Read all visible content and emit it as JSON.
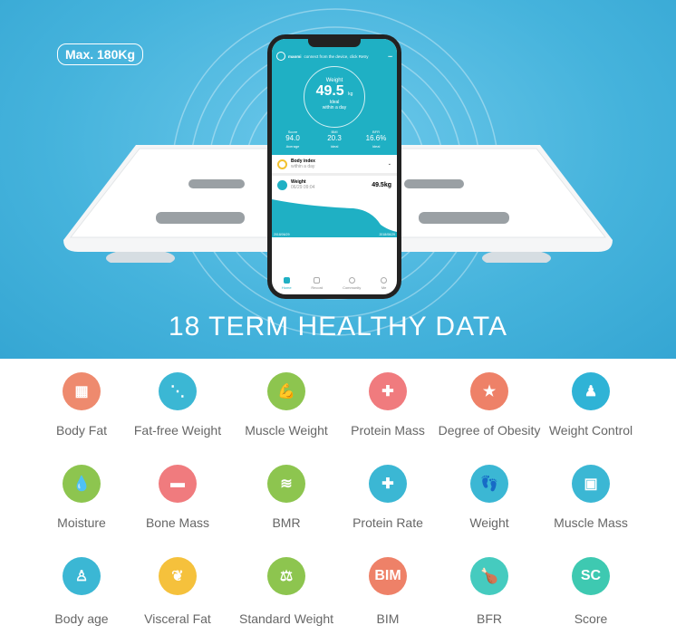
{
  "banner": {
    "badge": "Max. 180Kg",
    "title": "18 TERM HEALTHY DATA"
  },
  "app": {
    "brand": "maomi",
    "header_text": "connect from the device, click Retry",
    "menu": "•••",
    "gauge": {
      "label": "Weight",
      "value": "49.5",
      "unit": "kg",
      "status": "Ideal",
      "sub": "within a day"
    },
    "stats": [
      {
        "label": "Score",
        "value": "94.0",
        "note": "Average"
      },
      {
        "label": "BMI",
        "value": "20.3",
        "note": "Ideal"
      },
      {
        "label": "BFR",
        "value": "16.6%",
        "note": "Ideal"
      }
    ],
    "body_index": {
      "title": "Body index",
      "sub": "within a day"
    },
    "weight_card": {
      "title": "Weight",
      "sub": "06/29 09:04",
      "value": "49.5kg",
      "date_start": "2018/06/29",
      "date_end": "2018/06/29"
    },
    "nav": [
      "Home",
      "Record",
      "Community",
      "Me"
    ]
  },
  "items": [
    {
      "label": "Body Fat",
      "color": "#ee8a6e",
      "icon": "fat-cells-icon",
      "glyph": "▦"
    },
    {
      "label": "Fat-free Weight",
      "color": "#3bb7d4",
      "icon": "spine-icon",
      "glyph": "⋱"
    },
    {
      "label": "Muscle Weight",
      "color": "#8dc54f",
      "icon": "muscle-arm-icon",
      "glyph": "💪"
    },
    {
      "label": "Protein Mass",
      "color": "#f07b7e",
      "icon": "protein-cross-icon",
      "glyph": "✚"
    },
    {
      "label": "Degree of Obesity",
      "color": "#ee8168",
      "icon": "stars-podium-icon",
      "glyph": "★"
    },
    {
      "label": "Weight Control",
      "color": "#2fb3d6",
      "icon": "body-shape-icon",
      "glyph": "♟"
    },
    {
      "label": "Moisture",
      "color": "#8dc54f",
      "icon": "water-drop-icon",
      "glyph": "💧"
    },
    {
      "label": "Bone Mass",
      "color": "#f07b7e",
      "icon": "bone-icon",
      "glyph": "▬"
    },
    {
      "label": "BMR",
      "color": "#8dc54f",
      "icon": "heat-waves-icon",
      "glyph": "≋"
    },
    {
      "label": "Protein Rate",
      "color": "#3bb7d4",
      "icon": "protein-cross-icon",
      "glyph": "✚"
    },
    {
      "label": "Weight",
      "color": "#3bb7d4",
      "icon": "footprints-icon",
      "glyph": "👣"
    },
    {
      "label": "Muscle Mass",
      "color": "#3bb7d4",
      "icon": "torso-muscle-icon",
      "glyph": "▣"
    },
    {
      "label": "Body age",
      "color": "#3bb7d4",
      "icon": "person-icon",
      "glyph": "♙"
    },
    {
      "label": "Visceral Fat",
      "color": "#f5c13c",
      "icon": "lungs-icon",
      "glyph": "❦"
    },
    {
      "label": "Standard Weight",
      "color": "#8dc54f",
      "icon": "scale-icon",
      "glyph": "⚖"
    },
    {
      "label": "BIM",
      "color": "#ee8168",
      "icon": "bim-text-icon",
      "glyph": "BIM"
    },
    {
      "label": "BFR",
      "color": "#45cbbf",
      "icon": "roast-chicken-icon",
      "glyph": "🍗"
    },
    {
      "label": "Score",
      "color": "#3ec9b1",
      "icon": "sc-text-icon",
      "glyph": "SC"
    }
  ]
}
